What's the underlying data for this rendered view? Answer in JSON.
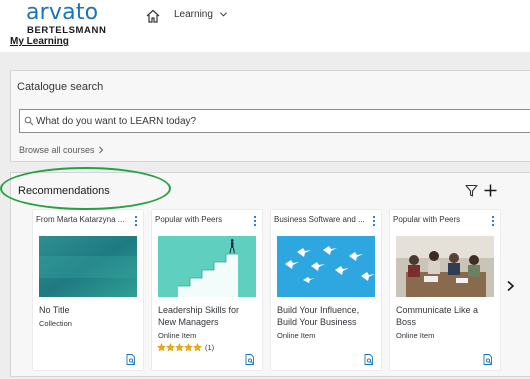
{
  "header": {
    "logo_main": "arvato",
    "logo_sub": "BERTELSMANN",
    "nav_menu_label": "Learning",
    "my_learning": "My Learning"
  },
  "catalogue": {
    "title": "Catalogue search",
    "search_placeholder": "What do you want to LEARN today?",
    "browse_label": "Browse all courses"
  },
  "recommendations": {
    "title": "Recommendations",
    "highlight_color": "#27a243",
    "tiles": [
      {
        "header": "From Marta Katarzyna ...",
        "title": "No Title",
        "type": "Collection",
        "image": "teal-gradient"
      },
      {
        "header": "Popular with Peers",
        "title": "Leadership Skills for New Managers",
        "type": "Online Item",
        "rating": 5,
        "rating_count": "(1)",
        "image": "staircase"
      },
      {
        "header": "Business Software and ...",
        "title": "Build Your Influence, Build Your Business",
        "type": "Online Item",
        "image": "birds"
      },
      {
        "header": "Popular with Peers",
        "title": "Communicate Like a Boss",
        "type": "Online Item",
        "image": "meeting"
      }
    ]
  },
  "colors": {
    "brand": "#1a74b9",
    "menu_dots": "#1a74b9",
    "star": "#f0ab00"
  }
}
